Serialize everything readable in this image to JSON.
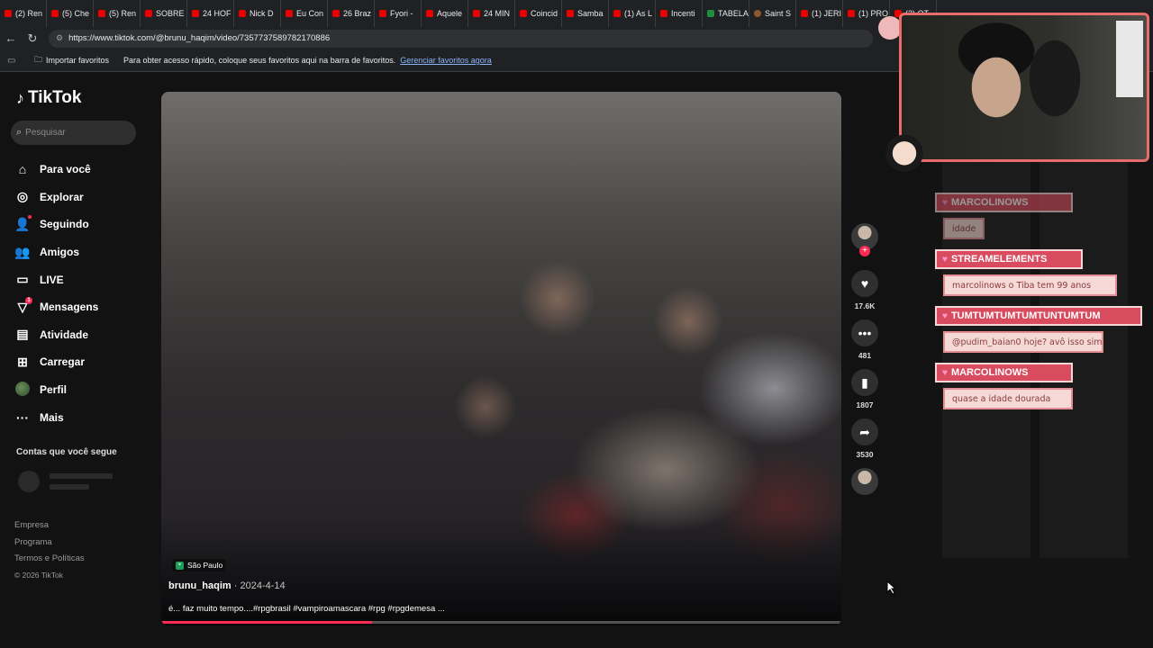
{
  "browser": {
    "tabs": [
      {
        "label": "(2) Ren",
        "icon": "youtube-icon"
      },
      {
        "label": "(5) Che",
        "icon": "youtube-icon"
      },
      {
        "label": "(5) Ren",
        "icon": "youtube-icon"
      },
      {
        "label": "SOBRE",
        "icon": "youtube-icon"
      },
      {
        "label": "24 HOF",
        "icon": "youtube-icon"
      },
      {
        "label": "Nick D",
        "icon": "youtube-icon"
      },
      {
        "label": "Eu Con",
        "icon": "youtube-icon"
      },
      {
        "label": "26 Braz",
        "icon": "youtube-icon"
      },
      {
        "label": "Fyori -",
        "icon": "youtube-icon"
      },
      {
        "label": "Aquele",
        "icon": "youtube-icon"
      },
      {
        "label": "24 MIN",
        "icon": "youtube-icon"
      },
      {
        "label": "Coincid",
        "icon": "youtube-icon"
      },
      {
        "label": "Samba",
        "icon": "youtube-icon"
      },
      {
        "label": "(1) As L",
        "icon": "youtube-icon"
      },
      {
        "label": "Incenti",
        "icon": "youtube-icon"
      },
      {
        "label": "TABELA",
        "icon": "sheets-icon"
      },
      {
        "label": "Saint S",
        "icon": "site-icon"
      },
      {
        "label": "(1) JERI",
        "icon": "youtube-icon"
      },
      {
        "label": "(1) PRO",
        "icon": "youtube-icon"
      },
      {
        "label": "(2) OT",
        "icon": "youtube-icon"
      }
    ],
    "url": "https://www.tiktok.com/@brunu_haqim/video/7357737589782170886",
    "bookmarks": {
      "import_label": "Importar favoritos",
      "hint": "Para obter acesso rápido, coloque seus favoritos aqui na barra de favoritos.",
      "manage_link": "Gerenciar favoritos agora"
    }
  },
  "tiktok": {
    "logo": "TikTok",
    "search_placeholder": "Pesquisar",
    "menu": [
      {
        "label": "Para você",
        "icon": "home-icon",
        "glyph": "⌂"
      },
      {
        "label": "Explorar",
        "icon": "compass-icon",
        "glyph": "◎"
      },
      {
        "label": "Seguindo",
        "icon": "following-icon",
        "glyph": "👤"
      },
      {
        "label": "Amigos",
        "icon": "friends-icon",
        "glyph": "👥"
      },
      {
        "label": "LIVE",
        "icon": "live-icon",
        "glyph": "▭"
      },
      {
        "label": "Mensagens",
        "icon": "messages-icon",
        "glyph": "▽"
      },
      {
        "label": "Atividade",
        "icon": "activity-icon",
        "glyph": "▤"
      },
      {
        "label": "Carregar",
        "icon": "upload-icon",
        "glyph": "⊞"
      },
      {
        "label": "Perfil",
        "icon": "profile-avatar-icon",
        "glyph": ""
      },
      {
        "label": "Mais",
        "icon": "more-icon",
        "glyph": "···"
      }
    ],
    "messages_badge": "1",
    "following_title": "Contas que você segue",
    "footer": [
      "Empresa",
      "Programa",
      "Termos e Políticas"
    ],
    "copyright": "© 2026 TikTok",
    "video": {
      "location": "São Paulo",
      "author": "brunu_haqim",
      "date": "2024-4-14",
      "caption": "é... faz muito tempo....#rpgbrasil #vampiroamascara #rpg #rpgdemesa ...",
      "progress": 0.31
    },
    "actions": {
      "likes": "17.6K",
      "comments": "481",
      "saves": "1807",
      "shares": "3530"
    }
  },
  "stream_chat": [
    {
      "user": "MARCOLINOWS",
      "message": "idade"
    },
    {
      "user": "STREAMELEMENTS",
      "message": "marcolinows o Tiba tem 99 anos"
    },
    {
      "user": "TUMTUMTUMTUMTUNTUMTUM",
      "message": "@pudim_baian0 hoje? avô isso sim"
    },
    {
      "user": "MARCOLINOWS",
      "message": "quase a idade dourada"
    }
  ],
  "colors": {
    "tiktok_accent": "#fe2c55",
    "chat_name_bg": "#d94b5e",
    "chat_msg_bg": "#f4d9d6",
    "webcam_border": "#e86c6c"
  }
}
